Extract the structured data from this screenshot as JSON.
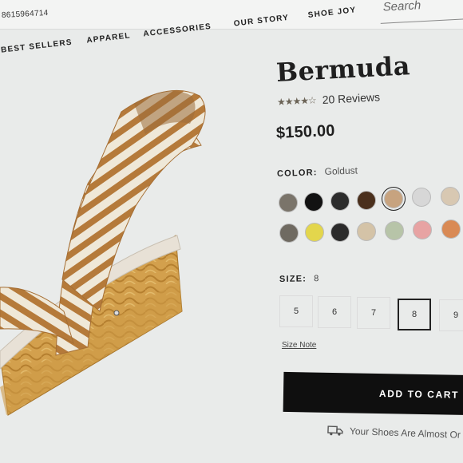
{
  "header": {
    "phone": "8615964714",
    "search": {
      "placeholder": "Search"
    }
  },
  "nav": [
    "BEST SELLERS",
    "APPAREL",
    "ACCESSORIES",
    "OUR STORY",
    "SHOE JOY"
  ],
  "product": {
    "title": "Bermuda",
    "rating": 4.5,
    "rating_stars_text": "★★★★☆",
    "reviews": "20 Reviews",
    "price": "$150.00",
    "color_label": "COLOR:",
    "color_value": "Goldust",
    "swatch_colors": [
      "#7a746a",
      "#121212",
      "#2c2c2c",
      "#4a2f1c",
      "#c7a37f",
      "#d7d7d7",
      "#d8c8b2",
      "#6f6a61",
      "#e3d64c",
      "#2b2b2b",
      "#d4c3a7",
      "#b7c4a8",
      "#e7a3a3",
      "#d98a55"
    ],
    "selected_swatch_index": 4,
    "size_label": "SIZE:",
    "size_value": "8",
    "sizes": [
      "5",
      "6",
      "7",
      "8",
      "9"
    ],
    "selected_size_index": 3,
    "size_note": "Size Note",
    "add_to_cart": "ADD TO CART",
    "shipping_note": "Your Shoes Are Almost Or"
  },
  "colors": {
    "strap_tan": "#b57a3a",
    "strap_cream": "#efe8d8",
    "espadrille": "#d3a04d",
    "button": "#0f0f0f"
  },
  "icons": {
    "truck": "truck-icon"
  }
}
